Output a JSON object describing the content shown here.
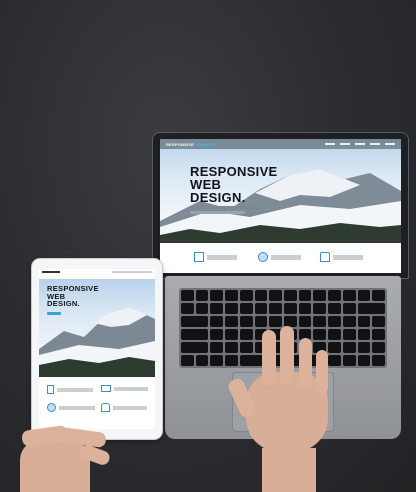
{
  "scene": {
    "background_color": "#2b2d30",
    "laptop_site": {
      "logo_main": "RESPONSIVE",
      "logo_accent": "WEBSITE",
      "headline_line1": "RESPONSIVE",
      "headline_line2": "WEB",
      "headline_line3": "DESIGN."
    },
    "tablet_site": {
      "headline_line1": "RESPONSIVE",
      "headline_line2": "WEB",
      "headline_line3": "DESIGN."
    },
    "colors": {
      "accent": "#3aa0da",
      "sky": "#b8d2ea",
      "snow": "#ffffff",
      "forest": "#2a3a2c",
      "skin": "#d9ae97"
    }
  }
}
